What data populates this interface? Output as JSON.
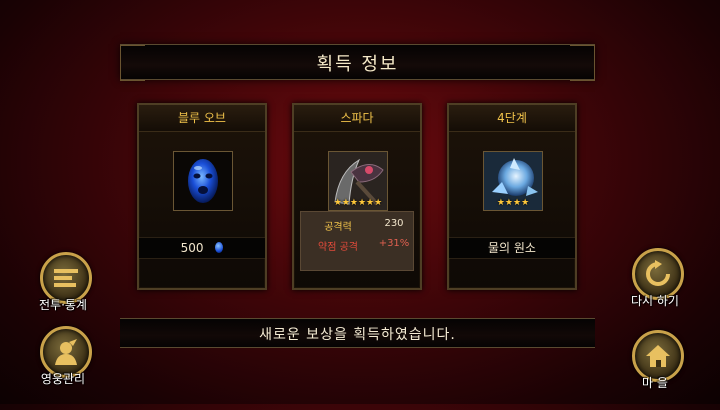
{
  "title": "획득 정보",
  "cards": [
    {
      "name": "블루 오브",
      "value_text": "500",
      "icon": "blue-orb-icon"
    },
    {
      "name": "스파다",
      "stars": "★★★★★★",
      "icon": "spada-weapon-icon",
      "stats": [
        {
          "label": "공격력",
          "value": "230"
        },
        {
          "label": "약점 공격",
          "value": "+31%"
        }
      ]
    },
    {
      "name": "4단계",
      "stars": "★★★★",
      "icon": "water-element-icon",
      "value_text": "물의 원소"
    }
  ],
  "message": "새로운 보상을 획득하였습니다.",
  "buttons": {
    "battle_stats": "전투·통계",
    "hero_manage": "영웅관리",
    "retry": "다시 하기",
    "village": "마 을"
  },
  "colors": {
    "card_header": "#f0c24a",
    "stat_label": "#f0c24a",
    "stat_weak_label": "#e04a3a",
    "stat_value": "#f2e6cc",
    "stat_weak_value": "#e06050",
    "gold_ring": "#c9a24a"
  }
}
